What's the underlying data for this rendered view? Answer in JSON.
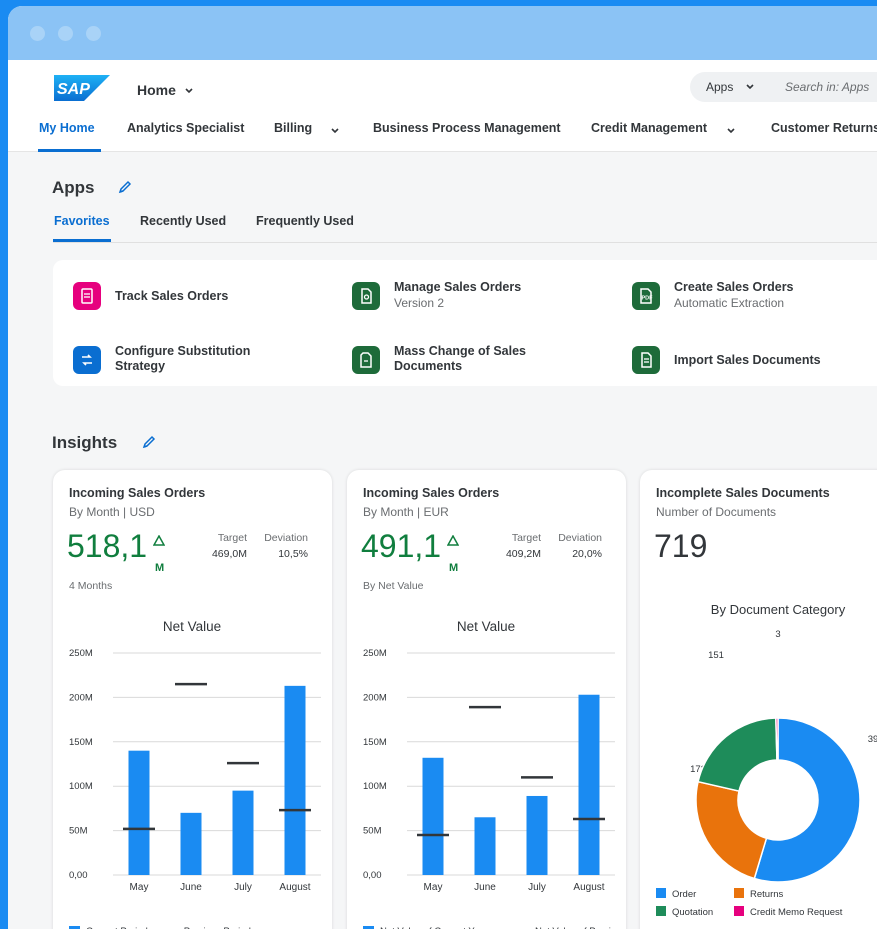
{
  "shell": {
    "home_label": "Home",
    "apps_select": "Apps",
    "search_placeholder": "Search in: Apps"
  },
  "nav": {
    "items": [
      {
        "label": "My Home",
        "active": true,
        "dropdown": false
      },
      {
        "label": "Analytics Specialist",
        "active": false,
        "dropdown": false
      },
      {
        "label": "Billing",
        "active": false,
        "dropdown": true
      },
      {
        "label": "Business Process Management",
        "active": false,
        "dropdown": false
      },
      {
        "label": "Credit Management",
        "active": false,
        "dropdown": true
      },
      {
        "label": "Customer Returns",
        "active": false,
        "dropdown": false
      }
    ]
  },
  "apps": {
    "title": "Apps",
    "tabs": [
      "Favorites",
      "Recently Used",
      "Frequently Used"
    ],
    "tiles": [
      {
        "title": "Track Sales Orders",
        "subtitle": "",
        "icon": "sales-order-track-icon",
        "color": "#e6007e"
      },
      {
        "title": "Manage Sales Orders",
        "subtitle": "Version 2",
        "icon": "document-manage-icon",
        "color": "#1e6b3a"
      },
      {
        "title": "Create Sales Orders",
        "subtitle": "Automatic Extraction",
        "icon": "pdf-icon",
        "color": "#1e6b3a"
      },
      {
        "title": "Configure Substitution Strategy",
        "title_line1": "Configure Substitution",
        "title_line2": "Strategy",
        "subtitle": "",
        "icon": "substitution-icon",
        "color": "#0a6ed1"
      },
      {
        "title": "Mass Change of Sales Documents",
        "title_line1": "Mass Change of Sales",
        "title_line2": "Documents",
        "subtitle": "",
        "icon": "mass-change-icon",
        "color": "#1e6b3a"
      },
      {
        "title": "Import Sales Documents",
        "subtitle": "",
        "icon": "import-icon",
        "color": "#1e6b3a"
      }
    ]
  },
  "insights": {
    "title": "Insights",
    "cards": [
      {
        "title": "Incoming Sales Orders",
        "subtitle": "By Month | USD",
        "kpi": "518,1",
        "unit": "M",
        "target_label": "Target",
        "target_value": "469,0M",
        "deviation_label": "Deviation",
        "deviation_value": "10,5%",
        "footer": "4 Months"
      },
      {
        "title": "Incoming Sales Orders",
        "subtitle": "By Month | EUR",
        "kpi": "491,1",
        "unit": "M",
        "target_label": "Target",
        "target_value": "409,2M",
        "deviation_label": "Deviation",
        "deviation_value": "20,0%",
        "footer": "By Net Value"
      },
      {
        "title": "Incomplete Sales Documents",
        "subtitle": "Number of Documents",
        "kpi": "719"
      }
    ]
  },
  "chart_data": [
    {
      "type": "bar",
      "title": "Net Value",
      "categories": [
        "May",
        "June",
        "July",
        "August"
      ],
      "ylim": [
        0,
        250
      ],
      "yticks": [
        "0,00",
        "50M",
        "100M",
        "150M",
        "200M",
        "250M"
      ],
      "series": [
        {
          "name": "Current Period",
          "values": [
            140,
            70,
            95,
            213
          ],
          "color": "#1a8bf2"
        },
        {
          "name": "Previous Period",
          "values": [
            52,
            215,
            126,
            73
          ],
          "color": "#32363a"
        }
      ]
    },
    {
      "type": "bar",
      "title": "Net Value",
      "categories": [
        "May",
        "June",
        "July",
        "August"
      ],
      "ylim": [
        0,
        250
      ],
      "yticks": [
        "0,00",
        "50M",
        "100M",
        "150M",
        "200M",
        "250M"
      ],
      "series": [
        {
          "name": "Net Value of Current Year",
          "values": [
            132,
            65,
            89,
            203
          ],
          "color": "#1a8bf2"
        },
        {
          "name": "Net Value of Previous Year",
          "values": [
            45,
            189,
            110,
            63
          ],
          "color": "#32363a"
        }
      ]
    },
    {
      "type": "pie",
      "title": "By Document Category",
      "labels": [
        "Order",
        "Returns",
        "Quotation",
        "Credit Memo Request"
      ],
      "values": [
        393,
        172,
        151,
        3
      ],
      "value_labels": [
        "39",
        "172",
        "151",
        "3"
      ],
      "colors": [
        "#1a8bf2",
        "#e9730c",
        "#1e8c5a",
        "#e6007e"
      ]
    }
  ]
}
